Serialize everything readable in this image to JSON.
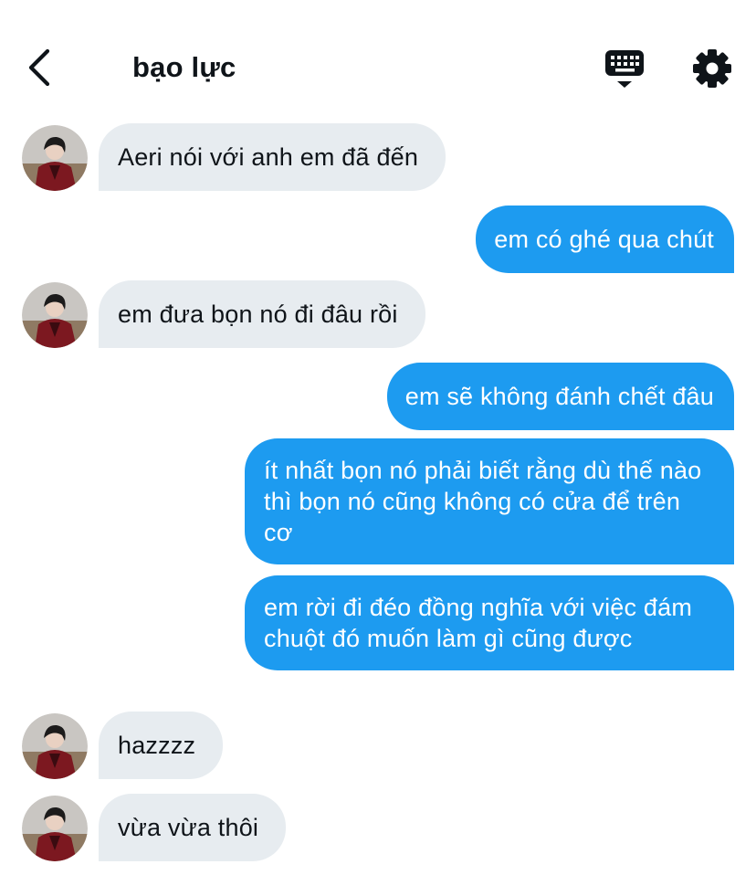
{
  "header": {
    "title": "bạo lực"
  },
  "icons": {
    "back": "back-arrow-icon",
    "keyboard": "keyboard-icon",
    "settings": "gear-icon"
  },
  "colors": {
    "outgoing_bubble": "#1d9bf0",
    "incoming_bubble": "#e7ecf0",
    "text": "#0f1419"
  },
  "messages": [
    {
      "direction": "in",
      "text": "Aeri nói với anh em đã đến"
    },
    {
      "direction": "out",
      "text": "em có ghé qua chút"
    },
    {
      "direction": "in",
      "text": "em đưa bọn nó đi đâu rồi"
    },
    {
      "direction": "out",
      "text": "em sẽ không đánh chết đâu"
    },
    {
      "direction": "out",
      "text": "ít nhất bọn nó phải biết rằng dù thế nào thì bọn nó cũng không có cửa để trên cơ"
    },
    {
      "direction": "out",
      "text": "em rời đi đéo đồng nghĩa với việc đám chuột đó muốn làm gì cũng được"
    },
    {
      "direction": "in",
      "text": "hazzzz"
    },
    {
      "direction": "in",
      "text": "vừa vừa thôi"
    }
  ]
}
